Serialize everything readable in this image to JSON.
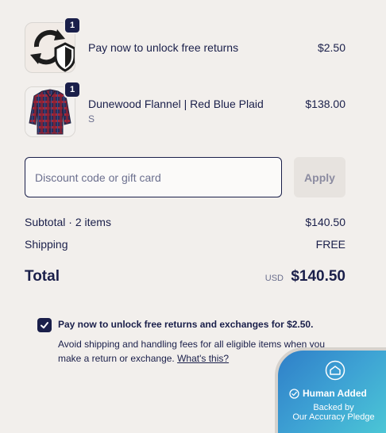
{
  "cart_items": [
    {
      "name": "Pay now to unlock free returns",
      "variant": "",
      "price": "$2.50",
      "quantity": "1",
      "image_icon": "returns-shield-icon"
    },
    {
      "name": "Dunewood Flannel | Red Blue Plaid",
      "variant": "S",
      "price": "$138.00",
      "quantity": "1",
      "image_icon": "flannel-shirt-image"
    }
  ],
  "discount": {
    "placeholder": "Discount code or gift card",
    "apply_label": "Apply"
  },
  "summary": {
    "subtotal_label": "Subtotal · 2 items",
    "subtotal_value": "$140.50",
    "shipping_label": "Shipping",
    "shipping_value": "FREE",
    "total_label": "Total",
    "total_currency": "USD",
    "total_value": "$140.50"
  },
  "returns_option": {
    "checked": true,
    "title": "Pay now to unlock free returns and exchanges for $2.50.",
    "description": "Avoid shipping and handling fees for all eligible items when you make a return or exchange.",
    "link_text": "What's this?"
  },
  "human_badge": {
    "title": "Human Added",
    "subtitle_line1": "Backed by",
    "subtitle_line2": "Our Accuracy Pledge"
  },
  "colors": {
    "background": "#f2efec",
    "text_primary": "#1a1f4a",
    "badge_gradient_start": "#2f7fc8",
    "badge_gradient_end": "#4fd0d6"
  }
}
